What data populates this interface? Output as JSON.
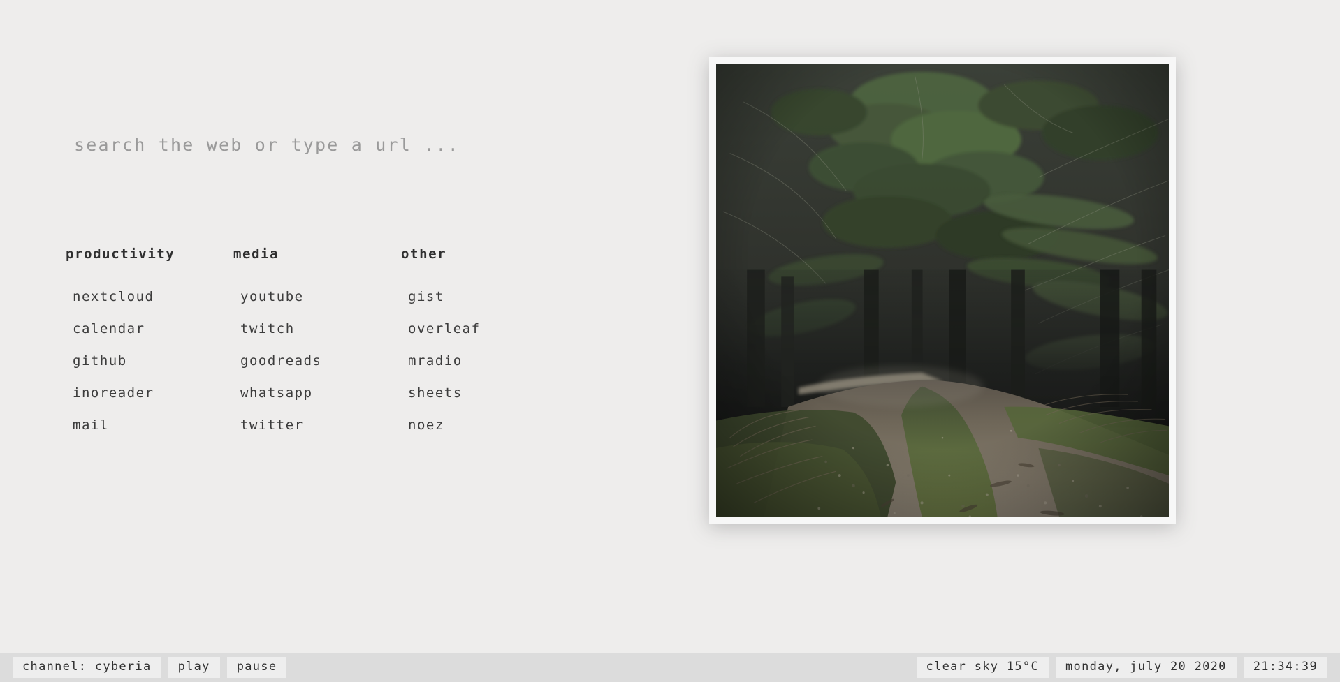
{
  "search": {
    "placeholder": "search the web or type a url ...",
    "value": ""
  },
  "columns": [
    {
      "header": "productivity",
      "links": [
        "nextcloud",
        "calendar",
        "github",
        "inoreader",
        "mail"
      ]
    },
    {
      "header": "media",
      "links": [
        "youtube",
        "twitch",
        "goodreads",
        "whatsapp",
        "twitter"
      ]
    },
    {
      "header": "other",
      "links": [
        "gist",
        "overleaf",
        "mradio",
        "sheets",
        "noez"
      ]
    }
  ],
  "photo": {
    "alt": "dark forest gravel path with conifer canopy"
  },
  "statusbar": {
    "channel": "channel: cyberia",
    "play": "play",
    "pause": "pause",
    "weather": "clear sky 15°C",
    "date": "monday, july 20 2020",
    "time": "21:34:39"
  },
  "colors": {
    "background": "#eeedec",
    "statusbar": "#dcdcdc",
    "pill": "#eeeeee",
    "text": "#3c3c3c",
    "placeholder": "#9a9a9a",
    "frame": "#f7f7f7"
  }
}
